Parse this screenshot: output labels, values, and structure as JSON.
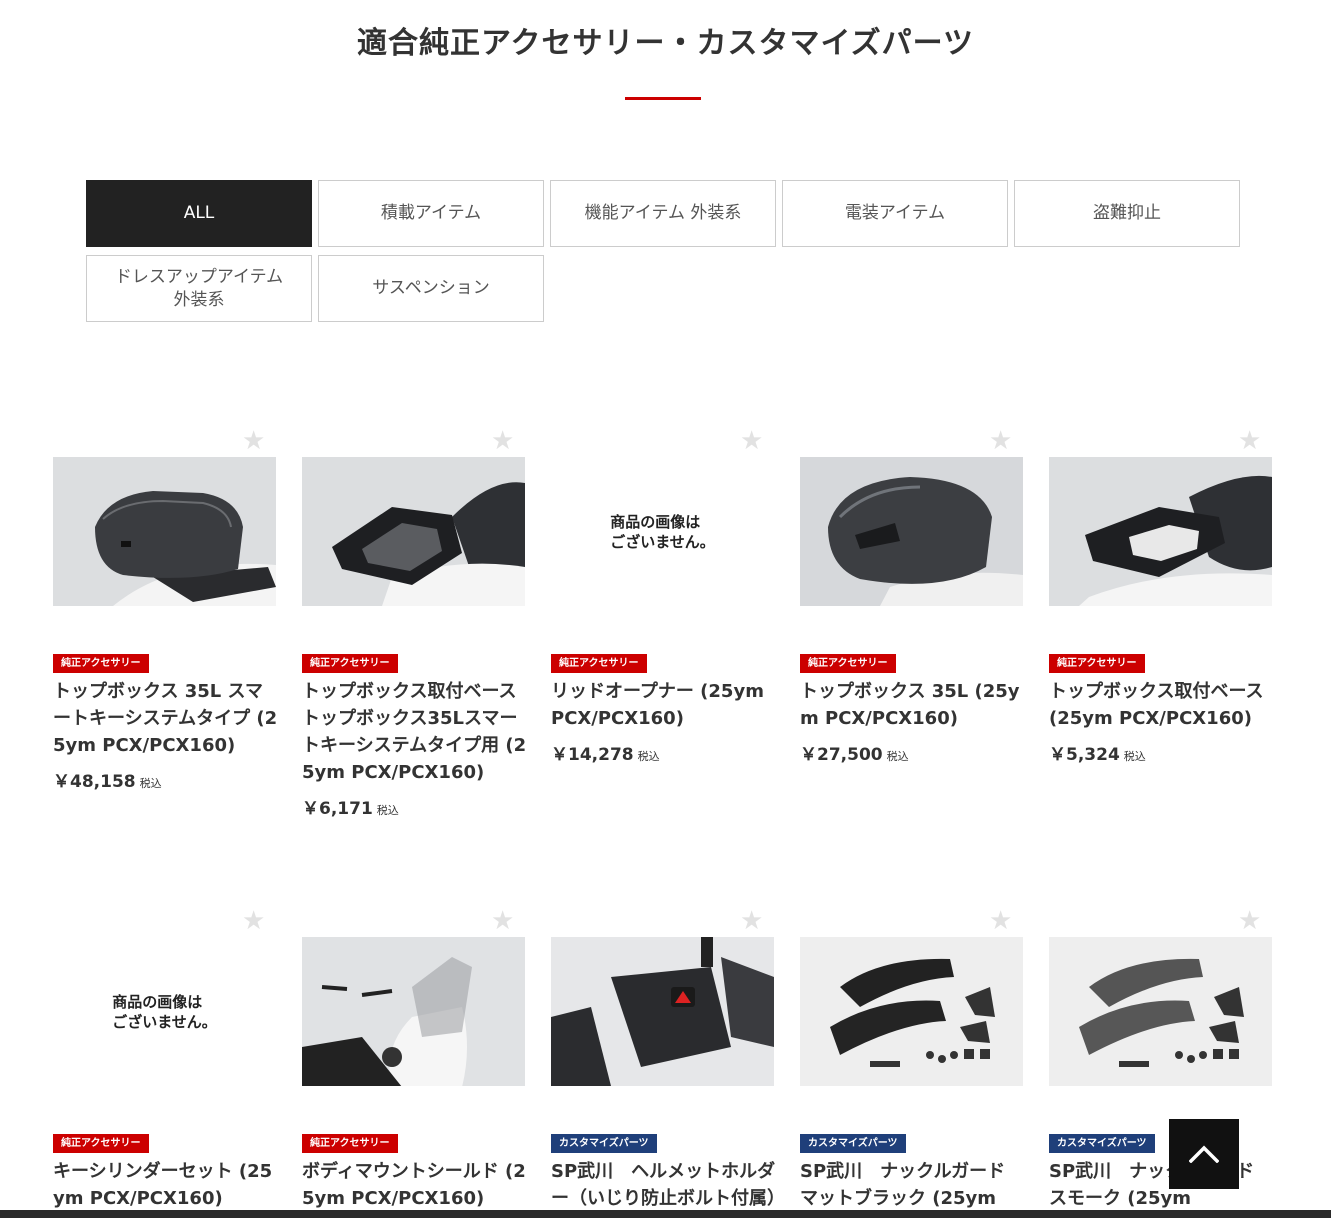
{
  "page": {
    "title": "適合純正アクセサリー・カスタマイズパーツ",
    "accent_color": "#cc0000"
  },
  "filters": [
    {
      "label": "ALL",
      "active": true
    },
    {
      "label": "積載アイテム",
      "active": false
    },
    {
      "label": "機能アイテム 外装系",
      "active": false
    },
    {
      "label": "電装アイテム",
      "active": false
    },
    {
      "label": "盗難抑止",
      "active": false
    },
    {
      "label": "ドレスアップアイテム 外装系",
      "active": false
    },
    {
      "label": "サスペンション",
      "active": false
    }
  ],
  "no_image_text": "商品の画像は\nございません。",
  "products": [
    {
      "badge": "純正アクセサリー",
      "badge_type": "genuine",
      "name": "トップボックス 35L スマートキーシステムタイプ (25ym PCX/PCX160)",
      "price": "￥48,158",
      "tax": "税込",
      "image": "topbox-smart"
    },
    {
      "badge": "純正アクセサリー",
      "badge_type": "genuine",
      "name": "トップボックス取付ベース トップボックス35Lスマートキーシステムタイプ用 (25ym PCX/PCX160)",
      "price": "￥6,171",
      "tax": "税込",
      "image": "rack-smart"
    },
    {
      "badge": "純正アクセサリー",
      "badge_type": "genuine",
      "name": "リッドオープナー (25ym PCX/PCX160)",
      "price": "￥14,278",
      "tax": "税込",
      "image": "none"
    },
    {
      "badge": "純正アクセサリー",
      "badge_type": "genuine",
      "name": "トップボックス 35L (25ym PCX/PCX160)",
      "price": "￥27,500",
      "tax": "税込",
      "image": "topbox"
    },
    {
      "badge": "純正アクセサリー",
      "badge_type": "genuine",
      "name": "トップボックス取付ベース (25ym PCX/PCX160)",
      "price": "￥5,324",
      "tax": "税込",
      "image": "rack"
    },
    {
      "badge": "純正アクセサリー",
      "badge_type": "genuine",
      "name": "キーシリンダーセット (25ym PCX/PCX160)",
      "price": "",
      "tax": "",
      "image": "none"
    },
    {
      "badge": "純正アクセサリー",
      "badge_type": "genuine",
      "name": "ボディマウントシールド (25ym PCX/PCX160)",
      "price": "",
      "tax": "",
      "image": "shield"
    },
    {
      "badge": "カスタマイズパーツ",
      "badge_type": "custom",
      "name": "SP武川　ヘルメットホルダー（いじり防止ボルト付属）",
      "price": "",
      "tax": "",
      "image": "helmet-holder"
    },
    {
      "badge": "カスタマイズパーツ",
      "badge_type": "custom",
      "name": "SP武川　ナックルガード マットブラック (25ym",
      "price": "",
      "tax": "",
      "image": "knuckle"
    },
    {
      "badge": "カスタマイズパーツ",
      "badge_type": "custom",
      "name": "SP武川　ナックルガード スモーク (25ym",
      "price": "",
      "tax": "",
      "image": "knuckle-smoke"
    }
  ],
  "icons": {
    "favorite": "star-icon",
    "back_to_top": "chevron-up-icon"
  }
}
